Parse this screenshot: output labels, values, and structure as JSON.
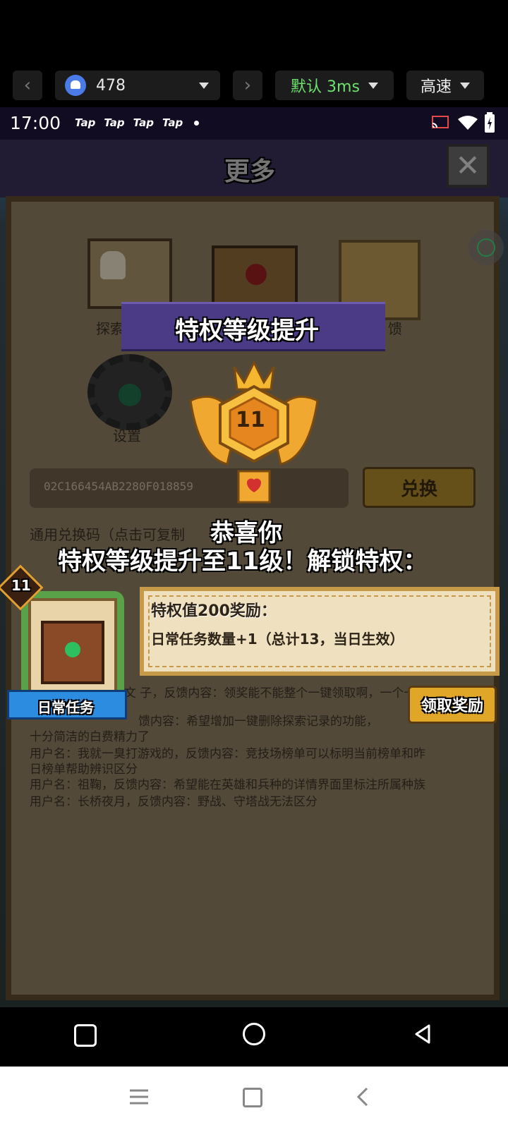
{
  "toolbar": {
    "device_label": "478",
    "network_label": "默认 3ms",
    "speed_label": "高速"
  },
  "status_bar": {
    "time": "17:00",
    "tap_items": [
      "Tap",
      "Tap",
      "Tap",
      "Tap"
    ]
  },
  "header": {
    "title": "更多"
  },
  "menu": {
    "explore_label": "探索",
    "feedback_label": "馈",
    "settings_label": "设置"
  },
  "redeem": {
    "code_value": "02C166454AB2280F01885",
    "code_suffix": "9",
    "button_label": "兑换",
    "hint": "通用兑换码（点击可复制"
  },
  "feedback_lines": [
    "文  子，反馈内容：领奖能不能整个一键领取啊，一个一个点",
    "馈内容：希望增加一键删除探索记录的功能，",
    "十分简洁的白费精力了",
    "用户名：我就一臭打游戏的，反馈内容：竞技场榜单可以标明当前榜单和昨",
    "日榜单帮助辨识区分",
    "用户名：祖鞠，反馈内容：希望能在英雄和兵种的详情界面里标注所属种族",
    "用户名：长桥夜月，反馈内容：野战、守塔战无法区分"
  ],
  "popup": {
    "title": "特权等级提升",
    "level": "11",
    "congrats": "恭喜你",
    "unlock_text": "特权等级提升至11级！解锁特权：",
    "reward_title": "特权值200奖励：",
    "reward_desc": "日常任务数量+1（总计13，当日生效）",
    "card_level": "11",
    "card_label": "日常任务",
    "claim_button": "领取奖励"
  },
  "colors": {
    "header_purple": "#3a2f5a",
    "banner_purple": "#4b3b86",
    "gold": "#d9a431",
    "card_blue": "#2c8de0",
    "network_green": "#6ee06e"
  }
}
